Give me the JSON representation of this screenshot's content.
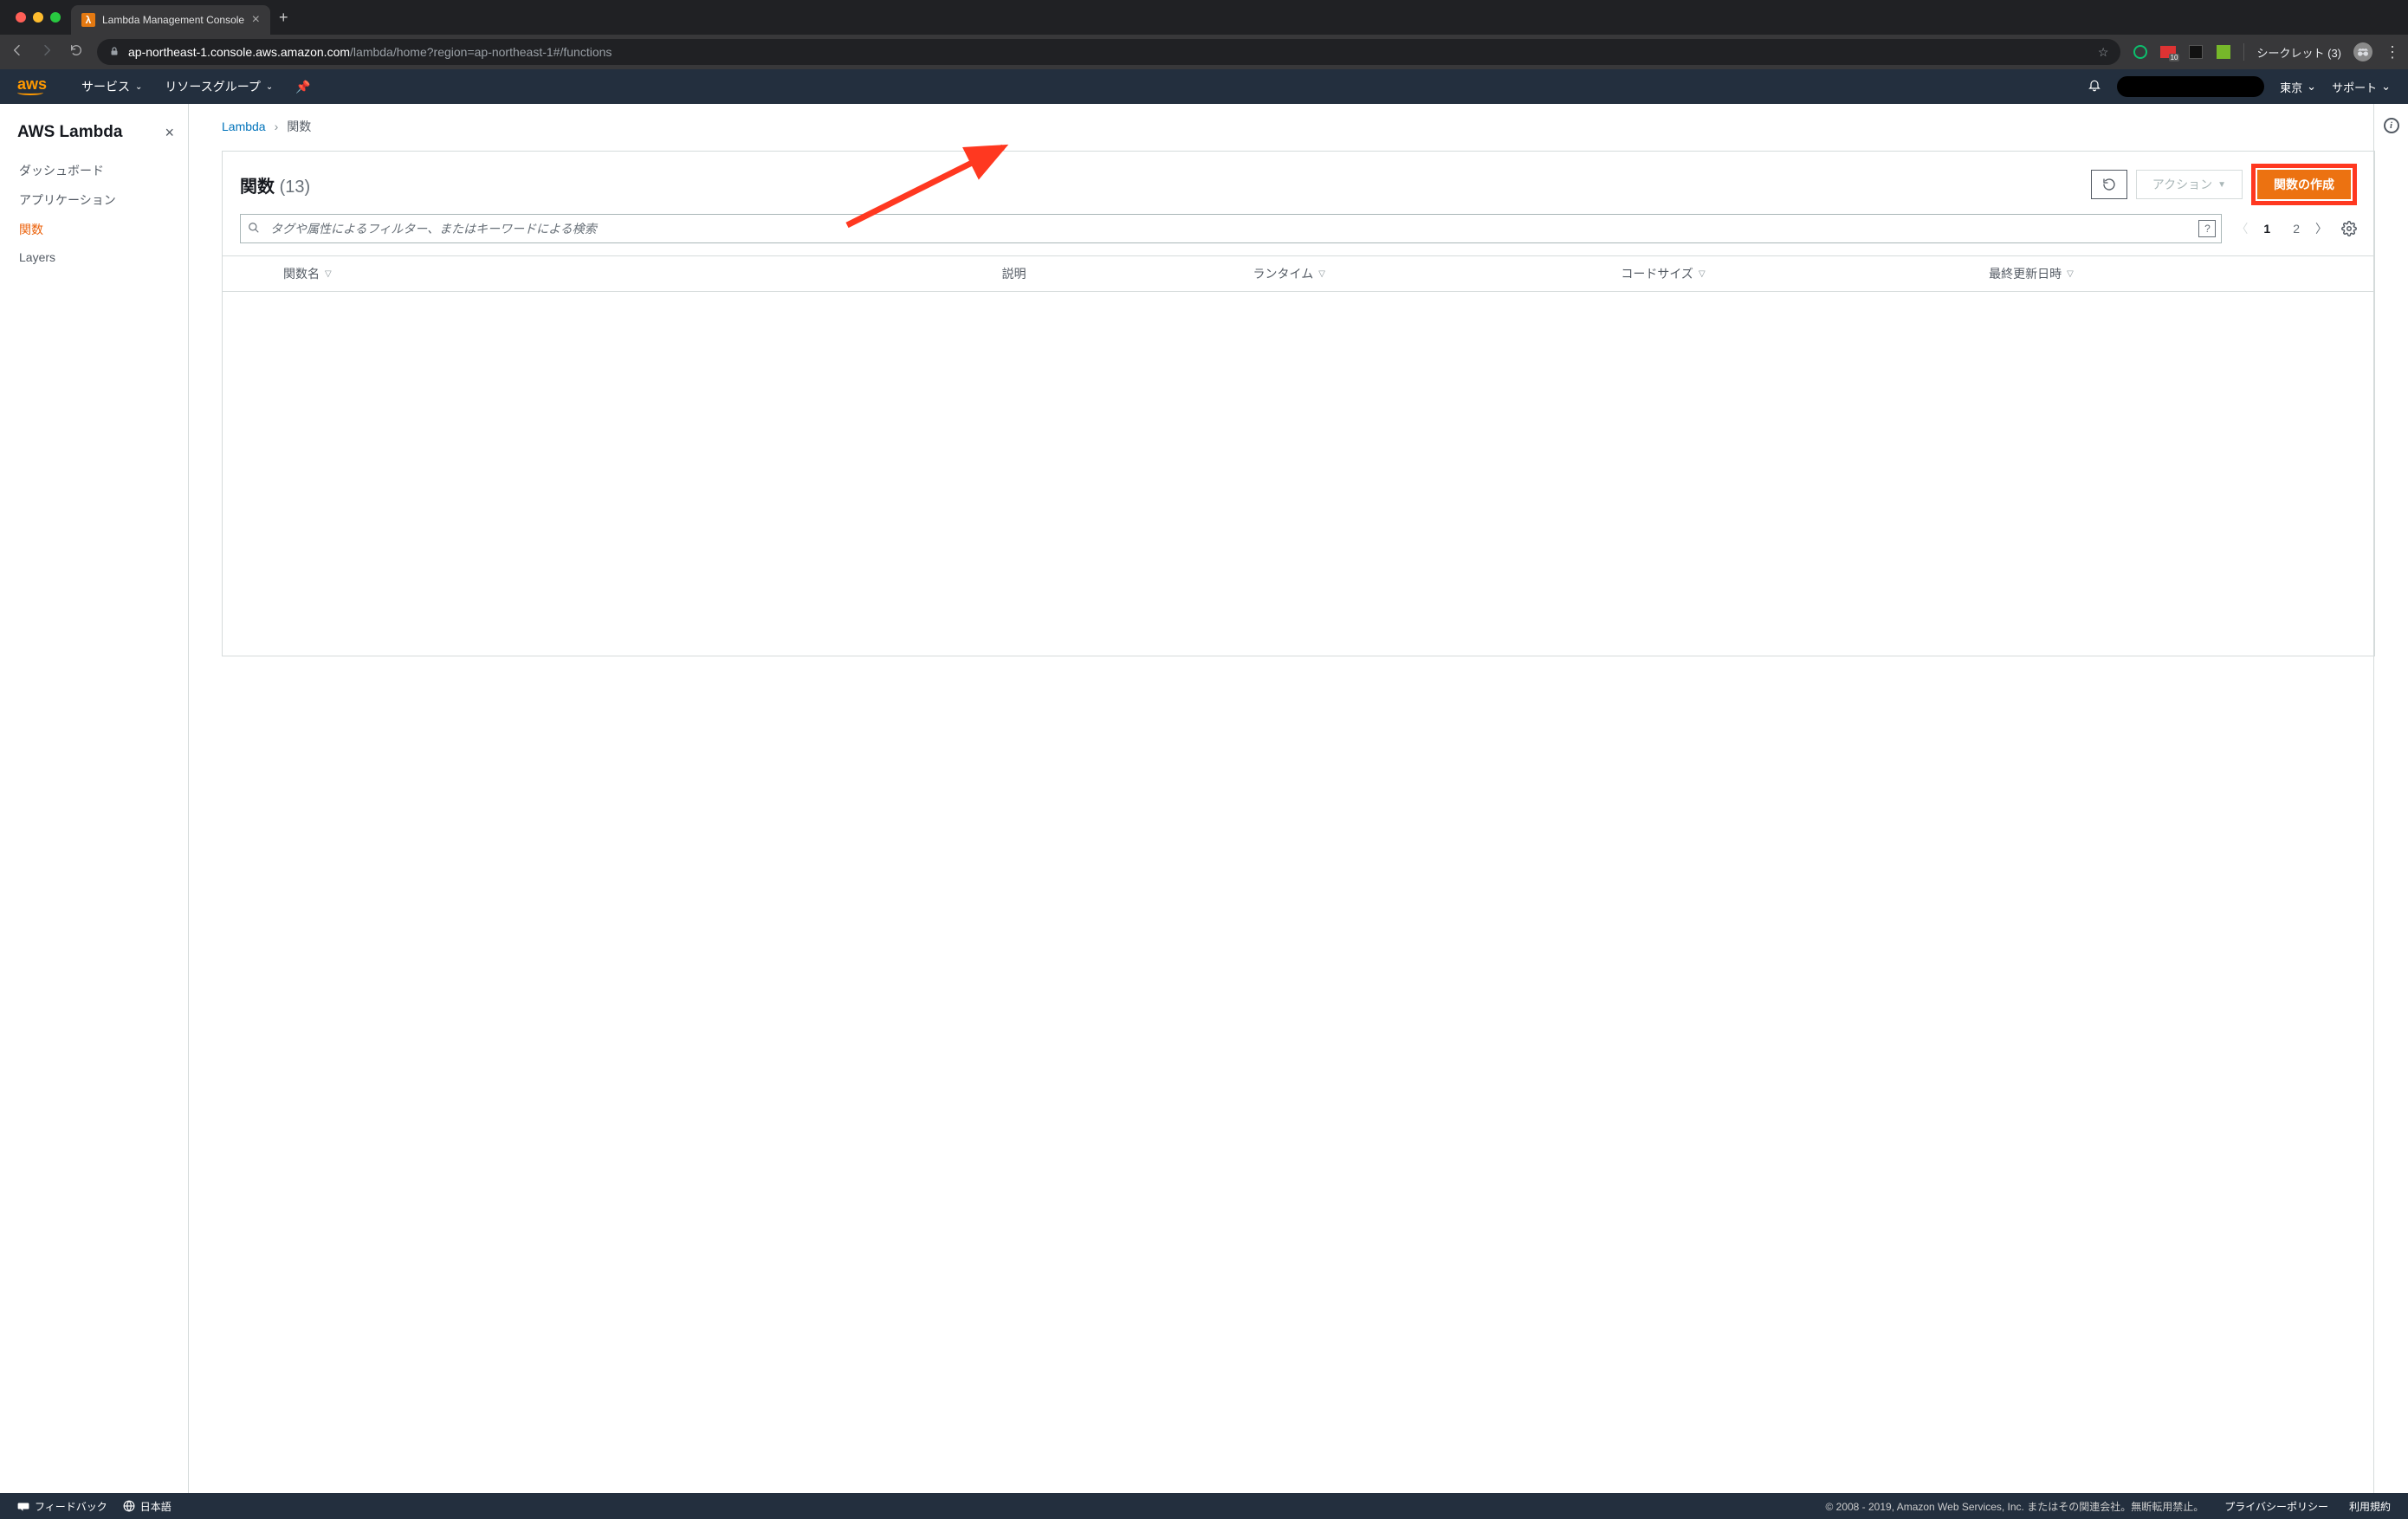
{
  "browser": {
    "tab_title": "Lambda Management Console",
    "url_host": "ap-northeast-1.console.aws.amazon.com",
    "url_path": "/lambda/home?region=ap-northeast-1#/functions",
    "incognito_label": "シークレット",
    "incognito_count": "(3)",
    "ext_badge": "10"
  },
  "aws_header": {
    "logo": "aws",
    "services": "サービス",
    "resource_groups": "リソースグループ",
    "region": "東京",
    "support": "サポート"
  },
  "sidebar": {
    "title": "AWS Lambda",
    "items": [
      {
        "label": "ダッシュボード",
        "active": false
      },
      {
        "label": "アプリケーション",
        "active": false
      },
      {
        "label": "関数",
        "active": true
      },
      {
        "label": "Layers",
        "active": false
      }
    ]
  },
  "breadcrumb": {
    "root": "Lambda",
    "current": "関数"
  },
  "panel": {
    "title": "関数",
    "count": "(13)",
    "actions_label": "アクション",
    "create_label": "関数の作成",
    "search_placeholder": "タグや属性によるフィルター、またはキーワードによる検索",
    "page_1": "1",
    "page_2": "2"
  },
  "columns": {
    "name": "関数名",
    "description": "説明",
    "runtime": "ランタイム",
    "code_size": "コードサイズ",
    "last_modified": "最終更新日時"
  },
  "footer": {
    "feedback": "フィードバック",
    "language": "日本語",
    "copyright": "© 2008 - 2019, Amazon Web Services, Inc. またはその関連会社。無断転用禁止。",
    "privacy": "プライバシーポリシー",
    "terms": "利用規約"
  }
}
